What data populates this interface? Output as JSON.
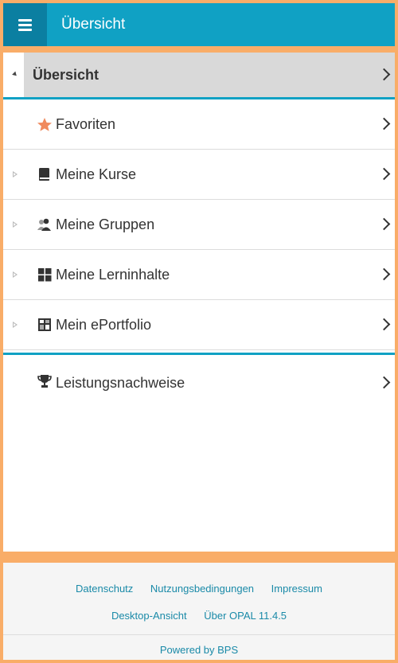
{
  "header": {
    "title": "Übersicht",
    "menu_icon": "hamburger-icon"
  },
  "nav": {
    "head": {
      "label": "Übersicht"
    },
    "items": [
      {
        "label": "Favoriten",
        "icon": "star-icon"
      },
      {
        "label": "Meine Kurse",
        "icon": "book-icon"
      },
      {
        "label": "Meine Gruppen",
        "icon": "group-icon"
      },
      {
        "label": "Meine Lerninhalte",
        "icon": "grid-icon"
      },
      {
        "label": "Mein ePortfolio",
        "icon": "portfolio-icon"
      },
      {
        "label": "Leistungsnachweise",
        "icon": "trophy-icon"
      }
    ]
  },
  "footer": {
    "links_row1": [
      "Datenschutz",
      "Nutzungsbedingungen",
      "Impressum"
    ],
    "links_row2": [
      "Desktop-Ansicht",
      "Über OPAL 11.4.5"
    ],
    "powered": "Powered by BPS"
  },
  "colors": {
    "accent": "#10a1c4",
    "accent_dark": "#0b7fa1",
    "frame": "#f9ad68",
    "star": "#f08a5d",
    "link": "#1a8aa8"
  }
}
